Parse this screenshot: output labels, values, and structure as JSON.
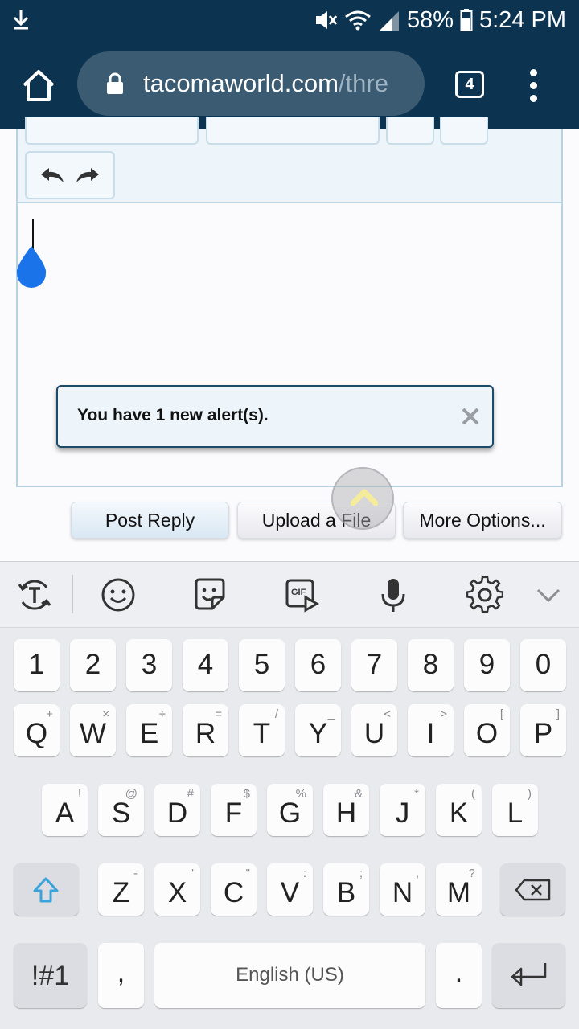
{
  "status_bar": {
    "battery": "58%",
    "time": "5:24 PM",
    "icons": [
      "download-icon",
      "mute-icon",
      "wifi-icon",
      "signal-icon",
      "battery-icon"
    ]
  },
  "browser": {
    "url_main": "tacomaworld.com",
    "url_dim": "/thre",
    "tab_count": "4",
    "icons": [
      "home-icon",
      "lock-icon",
      "overflow-menu-icon"
    ]
  },
  "editor": {
    "toolbar_icons": [
      "undo-icon",
      "redo-icon"
    ]
  },
  "alert": {
    "message": "You have 1 new alert(s).",
    "close_icon": "close-icon"
  },
  "actions": {
    "post_reply": "Post Reply",
    "upload_file": "Upload a File",
    "more_options": "More Options..."
  },
  "keyboard": {
    "toolbar_icons": [
      "translate-icon",
      "emoji-icon",
      "sticker-icon",
      "gif-icon",
      "microphone-icon",
      "settings-icon",
      "collapse-icon"
    ],
    "gif_label": "GIF",
    "row_numbers": [
      "1",
      "2",
      "3",
      "4",
      "5",
      "6",
      "7",
      "8",
      "9",
      "0"
    ],
    "row1": [
      {
        "k": "Q",
        "s": "+"
      },
      {
        "k": "W",
        "s": "×"
      },
      {
        "k": "E",
        "s": "÷"
      },
      {
        "k": "R",
        "s": "="
      },
      {
        "k": "T",
        "s": "/"
      },
      {
        "k": "Y",
        "s": "_"
      },
      {
        "k": "U",
        "s": "<"
      },
      {
        "k": "I",
        "s": ">"
      },
      {
        "k": "O",
        "s": "["
      },
      {
        "k": "P",
        "s": "]"
      }
    ],
    "row2": [
      {
        "k": "A",
        "s": "!"
      },
      {
        "k": "S",
        "s": "@"
      },
      {
        "k": "D",
        "s": "#"
      },
      {
        "k": "F",
        "s": "$"
      },
      {
        "k": "G",
        "s": "%"
      },
      {
        "k": "H",
        "s": "&"
      },
      {
        "k": "J",
        "s": "*"
      },
      {
        "k": "K",
        "s": "("
      },
      {
        "k": "L",
        "s": ")"
      }
    ],
    "row3": [
      {
        "k": "Z",
        "s": "-"
      },
      {
        "k": "X",
        "s": "'"
      },
      {
        "k": "C",
        "s": "\""
      },
      {
        "k": "V",
        "s": ":"
      },
      {
        "k": "B",
        "s": ";"
      },
      {
        "k": "N",
        "s": ","
      },
      {
        "k": "M",
        "s": "?"
      }
    ],
    "symbols_key": "!#1",
    "comma_key": ",",
    "space_label": "English (US)",
    "period_key": ".",
    "colors": {
      "accent": "#3aa3d9",
      "background": "#e9eaee",
      "key": "#fcfcfd"
    }
  },
  "colors": {
    "header": "#0c3350",
    "omnibox": "#3b5b73",
    "handle": "#1a73e8"
  }
}
